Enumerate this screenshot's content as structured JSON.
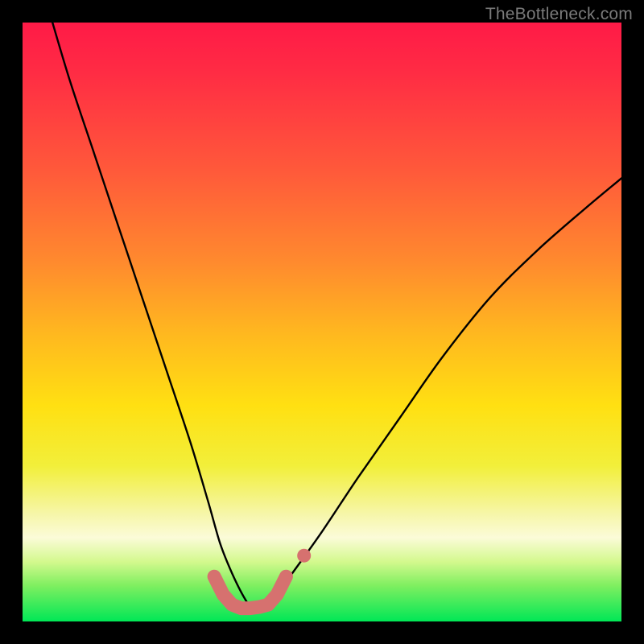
{
  "watermark": "TheBottleneck.com",
  "colors": {
    "frame": "#000000",
    "gradient_top": "#ff1a47",
    "gradient_mid": "#ffe012",
    "gradient_bottom": "#00e756",
    "curve": "#000000",
    "markers": "#d6716f"
  },
  "chart_data": {
    "type": "line",
    "title": "",
    "xlabel": "",
    "ylabel": "",
    "xlim": [
      0,
      100
    ],
    "ylim": [
      0,
      100
    ],
    "grid": false,
    "legend": false,
    "note": "Axes are unlabeled in the source image; x/y are normalized 0–100 percent of the plot area. y=0 at bottom (green), y=100 at top (red).",
    "series": [
      {
        "name": "bottleneck-curve",
        "x": [
          5,
          8,
          12,
          16,
          20,
          24,
          28,
          31,
          33,
          35,
          37,
          38.5,
          40,
          42,
          45,
          50,
          56,
          63,
          70,
          78,
          86,
          94,
          100
        ],
        "y": [
          100,
          90,
          78,
          66,
          54,
          42,
          30,
          20,
          13,
          8,
          4,
          2,
          2,
          4,
          8,
          15,
          24,
          34,
          44,
          54,
          62,
          69,
          74
        ]
      }
    ],
    "markers": {
      "name": "highlight-band",
      "note": "Thick salmon squared-U marker near the curve minimum plus one detached dot to its right.",
      "x": [
        32,
        33.5,
        35,
        36.5,
        38,
        39.5,
        41,
        42.5,
        44
      ],
      "y": [
        7.5,
        4.5,
        2.8,
        2.2,
        2.2,
        2.4,
        2.8,
        4.5,
        7.5
      ],
      "detached_point": {
        "x": 47,
        "y": 11
      }
    }
  }
}
